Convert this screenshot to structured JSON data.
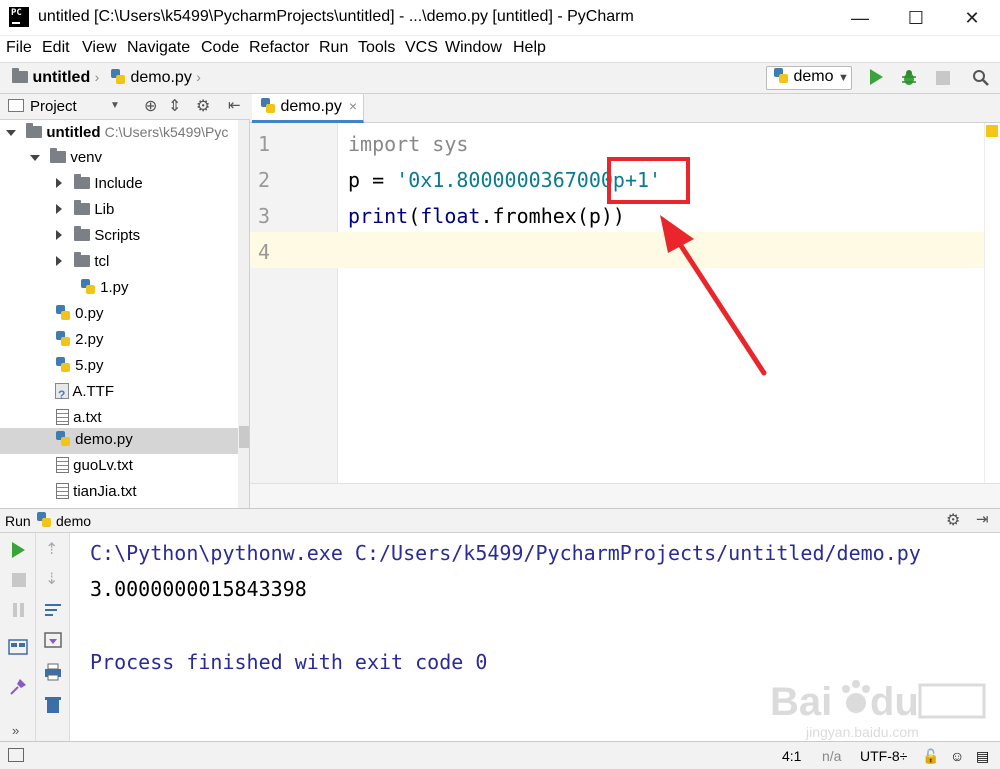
{
  "window": {
    "title": "untitled [C:\\Users\\k5499\\PycharmProjects\\untitled] - ...\\demo.py [untitled] - PyCharm",
    "app_icon_text": "PC",
    "controls": {
      "minimize": "—",
      "maximize": "☐",
      "close": "✕"
    }
  },
  "menu": [
    "File",
    "Edit",
    "View",
    "Navigate",
    "Code",
    "Refactor",
    "Run",
    "Tools",
    "VCS",
    "Window",
    "Help"
  ],
  "navbar": {
    "project_crumb": "untitled",
    "file_crumb": "demo.py",
    "run_config": "demo"
  },
  "project_panel": {
    "title": "Project",
    "root": {
      "name": "untitled",
      "path": "C:\\Users\\k5499\\Pyc"
    },
    "items": [
      {
        "name": "venv",
        "type": "folder",
        "level": 1,
        "expanded": true
      },
      {
        "name": "Include",
        "type": "folder",
        "level": 2,
        "expanded": false
      },
      {
        "name": "Lib",
        "type": "folder",
        "level": 2,
        "expanded": false
      },
      {
        "name": "Scripts",
        "type": "folder",
        "level": 2,
        "expanded": false
      },
      {
        "name": "tcl",
        "type": "folder",
        "level": 2,
        "expanded": false
      },
      {
        "name": "1.py",
        "type": "python",
        "level": 2
      },
      {
        "name": "0.py",
        "type": "python",
        "level": 1
      },
      {
        "name": "2.py",
        "type": "python",
        "level": 1
      },
      {
        "name": "5.py",
        "type": "python",
        "level": 1
      },
      {
        "name": "A.TTF",
        "type": "font",
        "level": 1
      },
      {
        "name": "a.txt",
        "type": "text",
        "level": 1
      },
      {
        "name": "demo.py",
        "type": "python",
        "level": 1,
        "selected": true
      },
      {
        "name": "guoLv.txt",
        "type": "text",
        "level": 1
      },
      {
        "name": "tianJia.txt",
        "type": "text",
        "level": 1
      }
    ]
  },
  "editor": {
    "tab": "demo.py",
    "tab_close": "×",
    "line_numbers": [
      "1",
      "2",
      "3",
      "4"
    ],
    "code": {
      "line1_kw": "import",
      "line1_mod": " sys",
      "line2_var": "p = ",
      "line2_str_a": "'0x1.8000000367000",
      "line2_str_b": "p+1'",
      "line3_print": "print",
      "line3_rest_a": "(",
      "line3_float": "float",
      "line3_rest_b": ".fromhex(p))"
    }
  },
  "run_panel": {
    "label": "Run",
    "config": "demo",
    "output": [
      "C:\\Python\\pythonw.exe C:/Users/k5499/PycharmProjects/untitled/demo.py",
      "3.0000000015843398",
      "",
      "Process finished with exit code 0"
    ]
  },
  "statusbar": {
    "position": "4:1",
    "line_sep": "n/a",
    "encoding": "UTF-8÷"
  },
  "colors": {
    "accent_blue": "#4083c9",
    "annotation_red": "#e8262b",
    "run_green": "#3aa33a"
  }
}
